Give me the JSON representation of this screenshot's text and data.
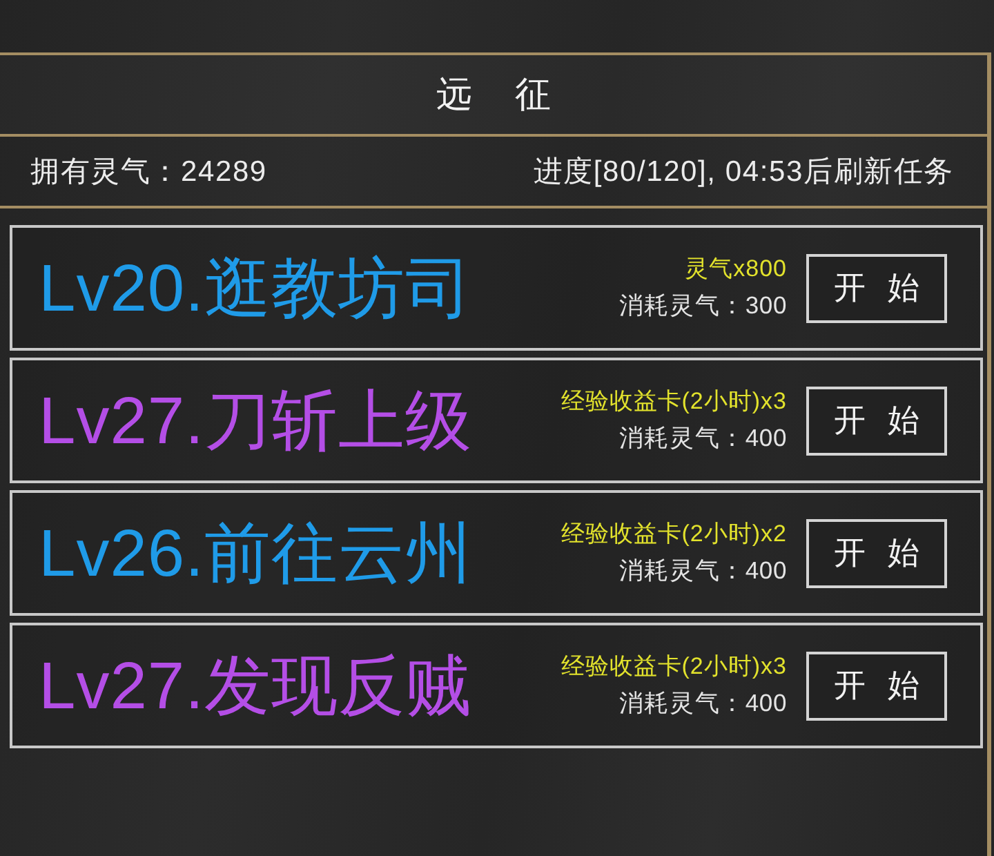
{
  "header": {
    "title": "远 征"
  },
  "info": {
    "balance": "拥有灵气：24289",
    "progress": "进度[80/120], 04:53后刷新任务"
  },
  "quests": [
    {
      "title": "Lv20.逛教坊司",
      "color": "#1f9be8",
      "reward": "灵气x800",
      "cost": "消耗灵气：300",
      "button": "开 始"
    },
    {
      "title": "Lv27.刀斩上级",
      "color": "#b44ee6",
      "reward": "经验收益卡(2小时)x3",
      "cost": "消耗灵气：400",
      "button": "开 始"
    },
    {
      "title": "Lv26.前往云州",
      "color": "#1f9be8",
      "reward": "经验收益卡(2小时)x2",
      "cost": "消耗灵气：400",
      "button": "开 始"
    },
    {
      "title": "Lv27.发现反贼",
      "color": "#b44ee6",
      "reward": "经验收益卡(2小时)x3",
      "cost": "消耗灵气：400",
      "button": "开 始"
    }
  ]
}
